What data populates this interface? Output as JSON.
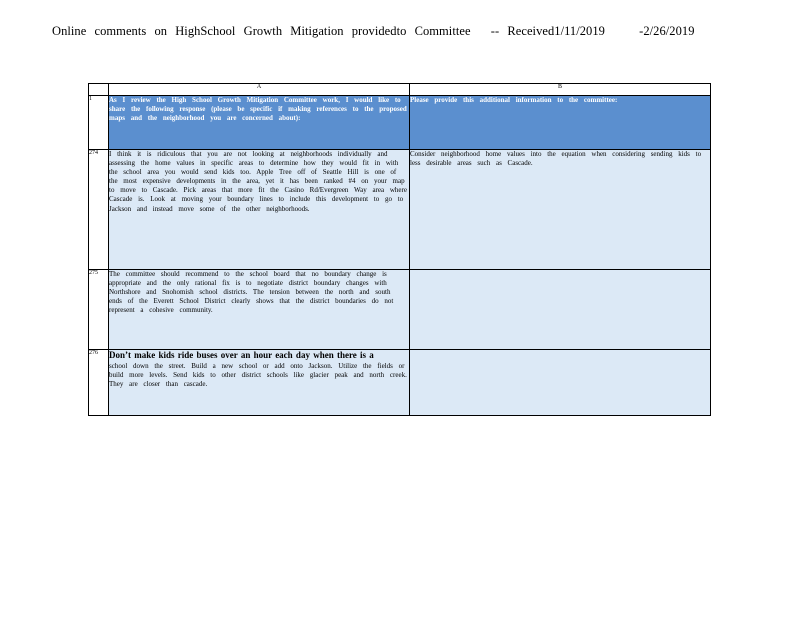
{
  "title": {
    "left": "Online   comments   on HighSchool  Growth  Mitigation   providedto   Committee",
    "right": "-- Received1/11/2019",
    "date2": "-2/26/2019"
  },
  "sheet": {
    "columns": [
      "A",
      "B"
    ],
    "header_row": {
      "row_number": "1",
      "a": "As I review the High School Growth Mitigation Committee work, I would like to share the following response (please be specific if making references to the proposed maps and the neighborhood you are concerned about):",
      "b": "Please provide this additional information to the committee:"
    },
    "rows": [
      {
        "row_number": "274",
        "a": "I think it is ridiculous that you are not looking at neighborhoods individually and assessing the home values in specific areas to determine how they would fit in with the school area you would send kids too. Apple Tree off of Seattle Hill is one of the most expensive developments in the area, yet it has been ranked #4 on your map to move to Cascade. Pick areas that more fit the Casino Rd/Evergreen Way area where Cascade is. Look at moving your boundary lines to include this development to go to Jackson and instead move some of the other neighborhoods.",
        "b": "Consider neighborhood home values into the equation when considering sending kids to less desirable areas such as Cascade."
      },
      {
        "row_number": "275",
        "a": "The committee should recommend to the school board that no boundary change is appropriate and the only rational fix is to negotiate district boundary changes with Northshore and Snohomish school districts. The tension between the north and south ends of the Everett School District clearly shows that the district boundaries do not represent a cohesive community.",
        "b": ""
      },
      {
        "row_number": "276",
        "a_first": "Don’t make kids ride buses over an hour each day when there is a",
        "a_rest": "school down the street. Build a new school or add onto Jackson. Utilize the fields or build more levels. Send kids to other district schools like glacier peak and north creek. They are closer than cascade.",
        "b": ""
      }
    ]
  }
}
